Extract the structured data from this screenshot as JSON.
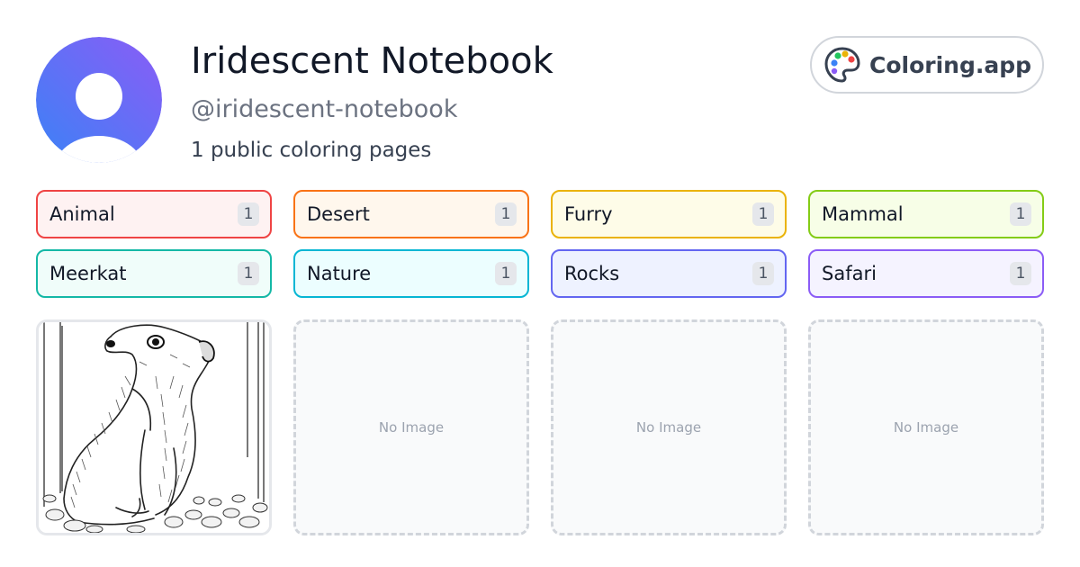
{
  "profile": {
    "name": "Iridescent Notebook",
    "handle": "@iridescent-notebook",
    "pages_count_text": "1 public coloring pages",
    "avatar_icon": "user-avatar-icon",
    "avatar_gradient": [
      "#3b82f6",
      "#8b5cf6"
    ]
  },
  "brand": {
    "label": "Coloring.app",
    "icon": "palette-icon"
  },
  "tags": [
    {
      "label": "Animal",
      "count": "1",
      "border": "#ef4444",
      "bg": "#fef2f2"
    },
    {
      "label": "Desert",
      "count": "1",
      "border": "#f97316",
      "bg": "#fff7ed"
    },
    {
      "label": "Furry",
      "count": "1",
      "border": "#eab308",
      "bg": "#fefce8"
    },
    {
      "label": "Mammal",
      "count": "1",
      "border": "#84cc16",
      "bg": "#f7fee7"
    },
    {
      "label": "Meerkat",
      "count": "1",
      "border": "#14b8a6",
      "bg": "#f0fdfa"
    },
    {
      "label": "Nature",
      "count": "1",
      "border": "#06b6d4",
      "bg": "#ecfeff"
    },
    {
      "label": "Rocks",
      "count": "1",
      "border": "#6366f1",
      "bg": "#eef2ff"
    },
    {
      "label": "Safari",
      "count": "1",
      "border": "#8b5cf6",
      "bg": "#f5f3ff"
    }
  ],
  "gallery": [
    {
      "type": "image",
      "subject": "meerkat coloring page"
    },
    {
      "type": "empty",
      "text": "No Image"
    },
    {
      "type": "empty",
      "text": "No Image"
    },
    {
      "type": "empty",
      "text": "No Image"
    }
  ]
}
